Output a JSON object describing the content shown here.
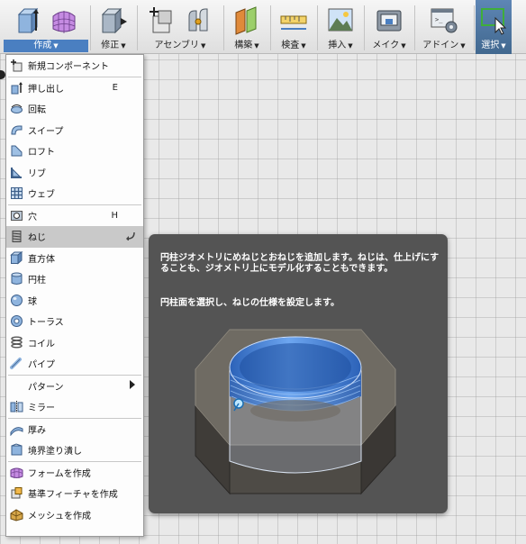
{
  "toolbar": {
    "groups": [
      {
        "label": "作成"
      },
      {
        "label": "修正"
      },
      {
        "label": "アセンブリ"
      },
      {
        "label": "構築"
      },
      {
        "label": "検査"
      },
      {
        "label": "挿入"
      },
      {
        "label": "メイク"
      },
      {
        "label": "アドイン"
      },
      {
        "label": "選択"
      }
    ]
  },
  "create_menu": {
    "items": [
      {
        "label": "新規コンポーネント",
        "icon": "new-component-icon"
      },
      {
        "label": "押し出し",
        "shortcut": "E",
        "icon": "extrude-icon"
      },
      {
        "label": "回転",
        "icon": "revolve-icon"
      },
      {
        "label": "スイープ",
        "icon": "sweep-icon"
      },
      {
        "label": "ロフト",
        "icon": "loft-icon"
      },
      {
        "label": "リブ",
        "icon": "rib-icon"
      },
      {
        "label": "ウェブ",
        "icon": "web-icon"
      },
      {
        "label": "穴",
        "shortcut": "H",
        "icon": "hole-icon"
      },
      {
        "label": "ねじ",
        "icon": "thread-icon"
      },
      {
        "label": "直方体",
        "icon": "box-icon"
      },
      {
        "label": "円柱",
        "icon": "cylinder-icon"
      },
      {
        "label": "球",
        "icon": "sphere-icon"
      },
      {
        "label": "トーラス",
        "icon": "torus-icon"
      },
      {
        "label": "コイル",
        "icon": "coil-icon"
      },
      {
        "label": "パイプ",
        "icon": "pipe-icon"
      },
      {
        "label": "パターン",
        "icon": "pattern-icon"
      },
      {
        "label": "ミラー",
        "icon": "mirror-icon"
      },
      {
        "label": "厚み",
        "icon": "thicken-icon"
      },
      {
        "label": "境界塗り潰し",
        "icon": "boundary-fill-icon"
      },
      {
        "label": "フォームを作成",
        "icon": "create-form-icon"
      },
      {
        "label": "基準フィーチャを作成",
        "icon": "create-base-feature-icon"
      },
      {
        "label": "メッシュを作成",
        "icon": "create-mesh-icon"
      }
    ]
  },
  "tooltip": {
    "description": "円柱ジオメトリにめねじとおねじを追加します。ねじは、仕上げにすることも、ジオメトリ上にモデル化することもできます。",
    "instruction": "円柱面を選択し、ねじの仕様を設定します。"
  },
  "colors": {
    "accent": "#4a7fc1",
    "thread_blue": "#3f7fd6",
    "tooltip_bg": "#545454",
    "menu_highlight": "#c9c9c9"
  }
}
